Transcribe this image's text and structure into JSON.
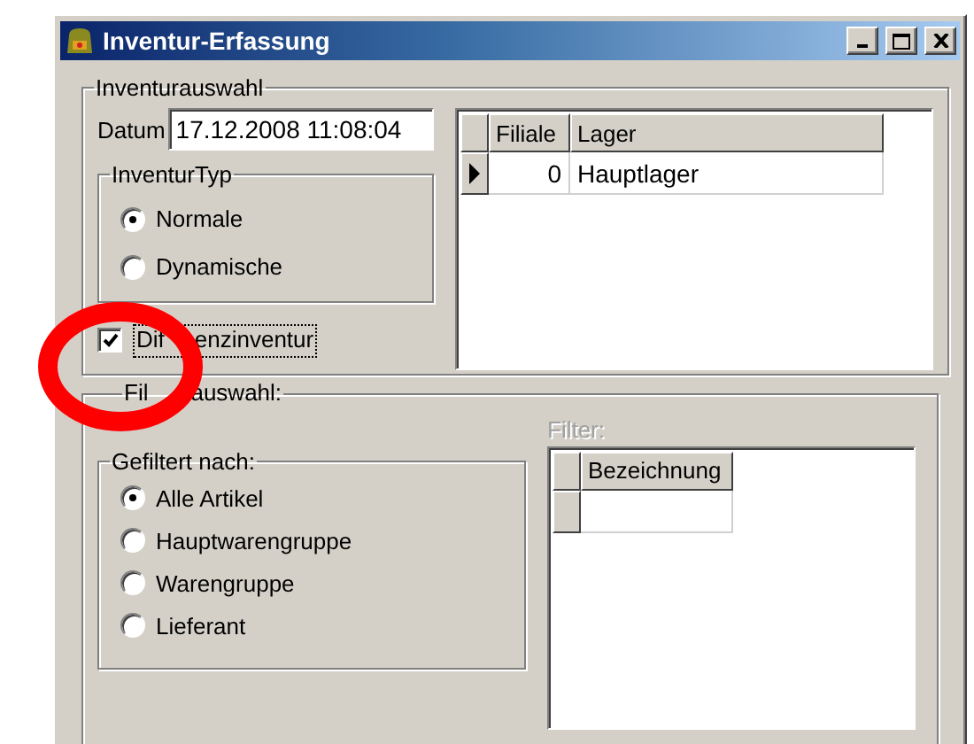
{
  "window": {
    "title": "Inventur-Erfassung"
  },
  "inventory_selection": {
    "title": "Inventurauswahl",
    "date_label": "Datum",
    "date_value": "17.12.2008 11:08:04",
    "type_group": {
      "title": "InventurTyp",
      "options": [
        {
          "label": "Normale",
          "selected": true
        },
        {
          "label": "Dynamische",
          "selected": false
        }
      ]
    },
    "difference_checkbox": {
      "label_parts": [
        "Dif",
        "enzinventur"
      ],
      "checked": true,
      "focused": true
    },
    "grid": {
      "columns": [
        "Filiale",
        "Lager"
      ],
      "rows": [
        {
          "current": true,
          "cells": [
            "0",
            "Hauptlager"
          ]
        }
      ]
    }
  },
  "filter_selection": {
    "title_parts": [
      "Fil",
      "auswahl:"
    ],
    "filter_group": {
      "title": "Gefiltert nach:",
      "options": [
        {
          "label": "Alle Artikel",
          "selected": true
        },
        {
          "label": "Hauptwarengruppe",
          "selected": false
        },
        {
          "label": "Warengruppe",
          "selected": false
        },
        {
          "label": "Lieferant",
          "selected": false
        }
      ]
    },
    "filter_label": {
      "text": "Filter:",
      "disabled": true
    },
    "grid": {
      "columns": [
        "Bezeichnung"
      ],
      "rows": [
        {
          "current": false
        }
      ]
    }
  },
  "annotation": {
    "kind": "circle"
  }
}
